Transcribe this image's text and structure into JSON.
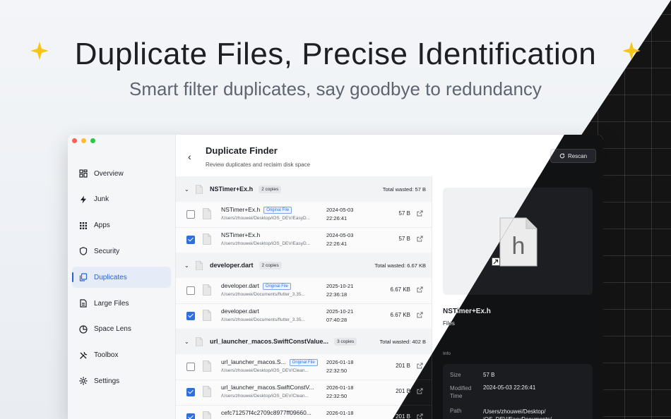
{
  "headline": "Duplicate Files, Precise Identification",
  "subheadline": "Smart filter duplicates, say goodbye to redundancy",
  "colors": {
    "accent": "#2d6fe0",
    "star": "#f5c518"
  },
  "sidebar": {
    "items": [
      {
        "label": "Overview",
        "icon": "overview-grid-icon"
      },
      {
        "label": "Junk",
        "icon": "lightning-icon"
      },
      {
        "label": "Apps",
        "icon": "apps-grid-icon"
      },
      {
        "label": "Security",
        "icon": "shield-icon"
      },
      {
        "label": "Duplicates",
        "icon": "duplicate-icon",
        "active": true
      },
      {
        "label": "Large Files",
        "icon": "large-files-icon"
      },
      {
        "label": "Space Lens",
        "icon": "pie-icon"
      },
      {
        "label": "Toolbox",
        "icon": "tools-icon"
      },
      {
        "label": "Settings",
        "icon": "gear-icon"
      }
    ]
  },
  "header": {
    "back": "‹",
    "title": "Duplicate Finder",
    "subtitle": "Review duplicates and reclaim disk space",
    "rescan": "Rescan"
  },
  "groups": [
    {
      "name": "NSTimer+Ex.h",
      "copies": "2 copies",
      "wasted": "Total wasted: 57 B",
      "rows": [
        {
          "name": "NSTimer+Ex.h",
          "original": true,
          "path": "/Users/zhouwei/Desktop/iOS_DEV/EasyD...",
          "date": "2024-05-03",
          "time": "22:26:41",
          "size": "57 B",
          "checked": false
        },
        {
          "name": "NSTimer+Ex.h",
          "original": false,
          "path": "/Users/zhouwei/Desktop/iOS_DEV/EasyD...",
          "date": "2024-05-03",
          "time": "22:26:41",
          "size": "57 B",
          "checked": true
        }
      ]
    },
    {
      "name": "developer.dart",
      "copies": "2 copies",
      "wasted": "Total wasted: 6.67 KB",
      "rows": [
        {
          "name": "developer.dart",
          "original": true,
          "path": "/Users/zhouwei/Documents/flutter_3.35...",
          "date": "2025-10-21",
          "time": "22:36:18",
          "size": "6.67 KB",
          "checked": false
        },
        {
          "name": "developer.dart",
          "original": false,
          "path": "/Users/zhouwei/Documents/flutter_3.35...",
          "date": "2025-10-21",
          "time": "07:40:28",
          "size": "6.67 KB",
          "checked": true
        }
      ]
    },
    {
      "name": "url_launcher_macos.SwiftConstValue...",
      "copies": "3 copies",
      "wasted": "Total wasted: 402 B",
      "rows": [
        {
          "name": "url_launcher_macos.S...",
          "original": true,
          "path": "/Users/zhouwei/Desktop/iOS_DEV/Clean...",
          "date": "2026-01-18",
          "time": "22:32:50",
          "size": "201 B",
          "checked": false
        },
        {
          "name": "url_launcher_macos.SwiftConstV...",
          "original": false,
          "path": "/Users/zhouwei/Desktop/iOS_DEV/Clean...",
          "date": "2026-01-18",
          "time": "22:32:50",
          "size": "201 B",
          "checked": true
        },
        {
          "name": "cefc71257f4c2709c8977ff09660...",
          "original": false,
          "path": "/Users/zhouwei/Desktop/iOS_DEV/Clean...",
          "date": "2026-01-18",
          "time": "22:32:50",
          "size": "201 B",
          "checked": true
        }
      ]
    }
  ],
  "original_label": "Original File",
  "detail": {
    "preview_letter": "h",
    "name": "NSTimer+Ex.h",
    "kind": "Files",
    "info_label": "Info",
    "size_key": "Size",
    "size_val": "57 B",
    "mod_key": "Modified Time",
    "mod_val": "2024-05-03 22:26:41",
    "path_key": "Path",
    "path_val": "/Users/zhouwei/Desktop/ iOS_DEV/EasyDocuments/"
  }
}
